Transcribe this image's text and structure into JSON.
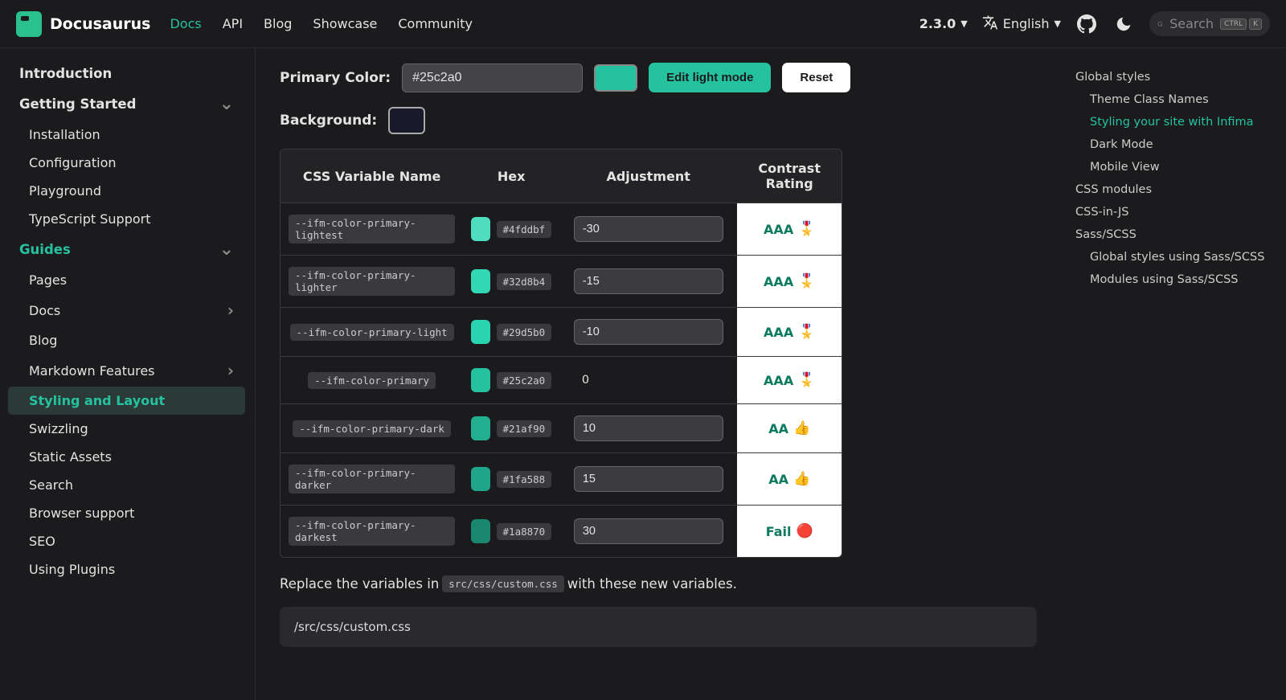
{
  "brand": "Docusaurus",
  "nav": {
    "links": [
      "Docs",
      "API",
      "Blog",
      "Showcase",
      "Community"
    ],
    "activeIndex": 0,
    "version": "2.3.0",
    "language": "English",
    "searchPlaceholder": "Search",
    "kbd1": "CTRL",
    "kbd2": "K"
  },
  "sidebar": [
    {
      "label": "Introduction",
      "type": "top"
    },
    {
      "label": "Getting Started",
      "type": "top",
      "expand": "down"
    },
    {
      "label": "Installation",
      "type": "sub"
    },
    {
      "label": "Configuration",
      "type": "sub"
    },
    {
      "label": "Playground",
      "type": "sub"
    },
    {
      "label": "TypeScript Support",
      "type": "sub"
    },
    {
      "label": "Guides",
      "type": "cat",
      "expand": "down"
    },
    {
      "label": "Pages",
      "type": "sub"
    },
    {
      "label": "Docs",
      "type": "sub",
      "expand": "right"
    },
    {
      "label": "Blog",
      "type": "sub"
    },
    {
      "label": "Markdown Features",
      "type": "sub",
      "expand": "right"
    },
    {
      "label": "Styling and Layout",
      "type": "sub",
      "active": true
    },
    {
      "label": "Swizzling",
      "type": "sub"
    },
    {
      "label": "Static Assets",
      "type": "sub"
    },
    {
      "label": "Search",
      "type": "sub"
    },
    {
      "label": "Browser support",
      "type": "sub"
    },
    {
      "label": "SEO",
      "type": "sub"
    },
    {
      "label": "Using Plugins",
      "type": "sub"
    }
  ],
  "toc": [
    {
      "label": "Global styles",
      "level": 1
    },
    {
      "label": "Theme Class Names",
      "level": 2
    },
    {
      "label": "Styling your site with Infima",
      "level": 2,
      "active": true
    },
    {
      "label": "Dark Mode",
      "level": 2
    },
    {
      "label": "Mobile View",
      "level": 2
    },
    {
      "label": "CSS modules",
      "level": 1
    },
    {
      "label": "CSS-in-JS",
      "level": 1
    },
    {
      "label": "Sass/SCSS",
      "level": 1
    },
    {
      "label": "Global styles using Sass/SCSS",
      "level": 2
    },
    {
      "label": "Modules using Sass/SCSS",
      "level": 2
    }
  ],
  "content": {
    "primaryLabel": "Primary Color:",
    "primaryValue": "#25c2a0",
    "primarySwatch": "#25c2a0",
    "editBtn": "Edit light mode",
    "resetBtn": "Reset",
    "bgLabel": "Background:",
    "bgSwatch": "#181a2a",
    "tableHead": [
      "CSS Variable Name",
      "Hex",
      "Adjustment",
      "Contrast Rating"
    ],
    "rows": [
      {
        "var": "--ifm-color-primary-lightest",
        "hex": "#4fddbf",
        "swatch": "#4fddbf",
        "adj": "-30",
        "rating": "AAA",
        "icon": "🎖️",
        "editable": true
      },
      {
        "var": "--ifm-color-primary-lighter",
        "hex": "#32d8b4",
        "swatch": "#32d8b4",
        "adj": "-15",
        "rating": "AAA",
        "icon": "🎖️",
        "editable": true
      },
      {
        "var": "--ifm-color-primary-light",
        "hex": "#29d5b0",
        "swatch": "#29d5b0",
        "adj": "-10",
        "rating": "AAA",
        "icon": "🎖️",
        "editable": true
      },
      {
        "var": "--ifm-color-primary",
        "hex": "#25c2a0",
        "swatch": "#25c2a0",
        "adj": "0",
        "rating": "AAA",
        "icon": "🎖️",
        "editable": false
      },
      {
        "var": "--ifm-color-primary-dark",
        "hex": "#21af90",
        "swatch": "#21af90",
        "adj": "10",
        "rating": "AA",
        "icon": "👍",
        "editable": true
      },
      {
        "var": "--ifm-color-primary-darker",
        "hex": "#1fa588",
        "swatch": "#1fa588",
        "adj": "15",
        "rating": "AA",
        "icon": "👍",
        "editable": true
      },
      {
        "var": "--ifm-color-primary-darkest",
        "hex": "#1a8870",
        "swatch": "#1a8870",
        "adj": "30",
        "rating": "Fail",
        "icon": "🔴",
        "editable": true
      }
    ],
    "replaceTextPre": "Replace the variables in ",
    "replaceCode": "src/css/custom.css",
    "replaceTextPost": " with these new variables.",
    "codeBlockTitle": "/src/css/custom.css"
  }
}
